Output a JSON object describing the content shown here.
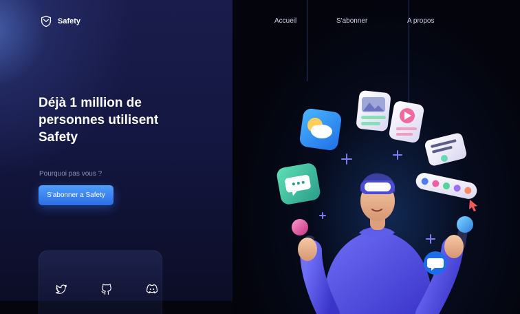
{
  "brand": {
    "name": "Safety",
    "logo_icon": "shield-icon"
  },
  "nav": {
    "items": [
      {
        "label": "Accueil"
      },
      {
        "label": "S'abonner"
      },
      {
        "label": "A propos"
      }
    ]
  },
  "hero": {
    "headline_line1": "Déjà 1 million de",
    "headline_line2": "personnes utilisent",
    "headline_line3": "Safety",
    "subtitle": "Pourquoi pas vous ?",
    "cta_label": "S'abonner a Safety"
  },
  "social": {
    "icons": [
      "twitter-icon",
      "github-icon",
      "discord-icon"
    ]
  },
  "colors": {
    "accent": "#3b82f6",
    "background_left": "#171a45",
    "background_right": "#03040c"
  }
}
